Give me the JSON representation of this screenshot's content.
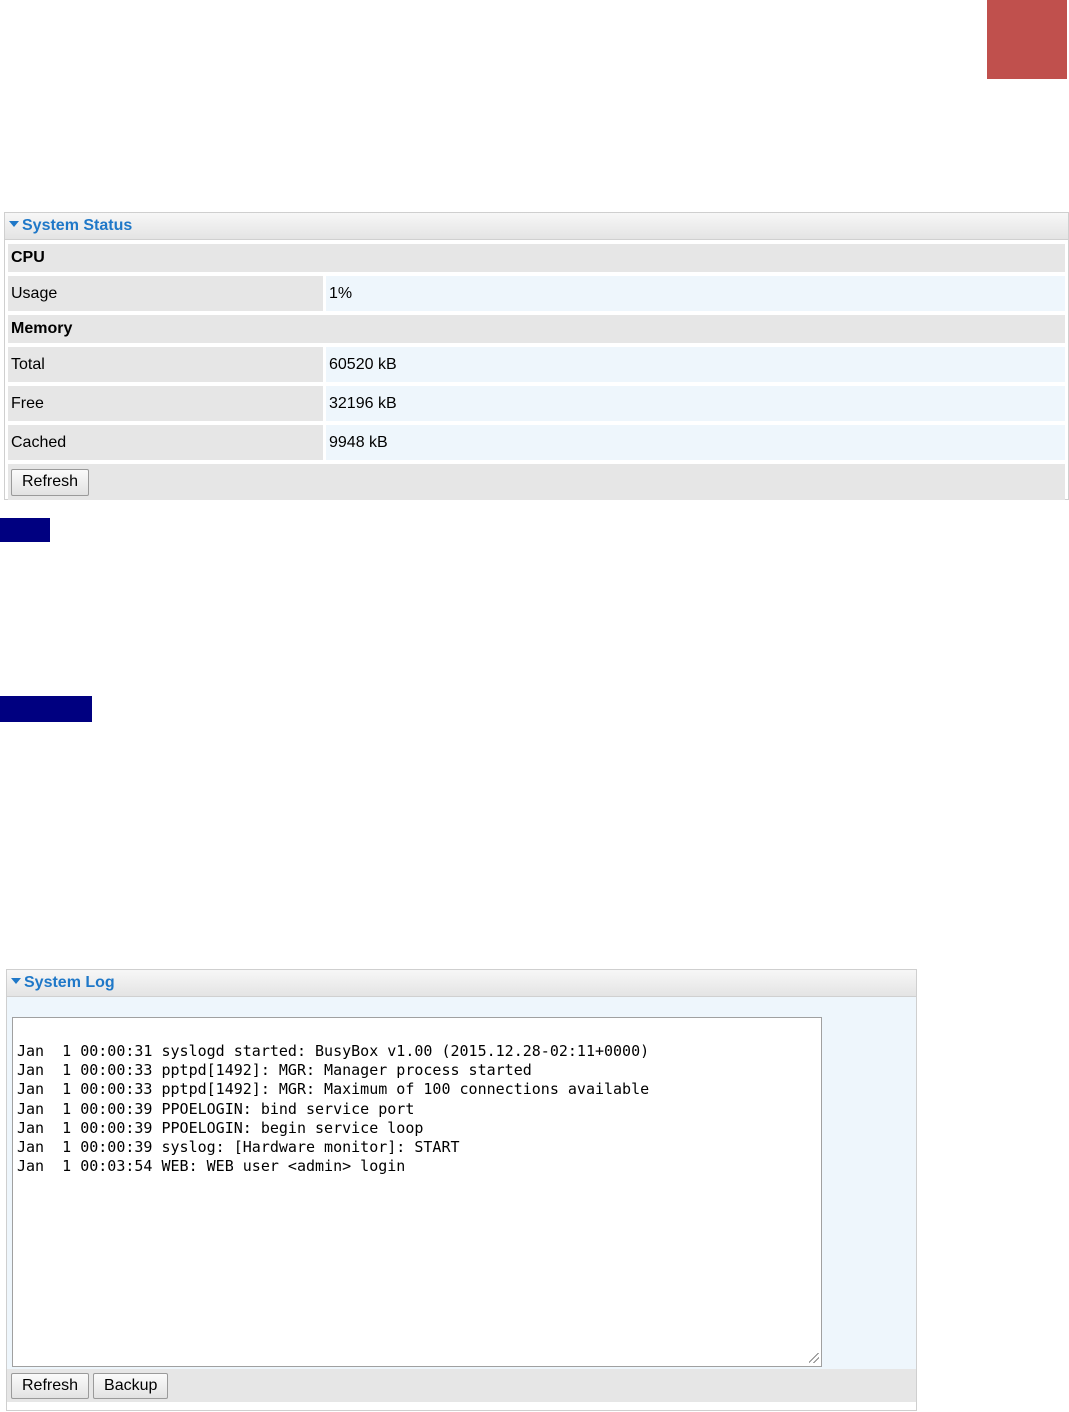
{
  "colors": {
    "corner_block": "#c0504d",
    "nav_block": "#000080",
    "panel_title": "#1f78c8"
  },
  "system_status": {
    "title": "System Status",
    "cpu": {
      "heading": "CPU",
      "usage_label": "Usage",
      "usage_value": "1%"
    },
    "memory": {
      "heading": "Memory",
      "rows": [
        {
          "label": "Total",
          "value": "60520 kB"
        },
        {
          "label": "Free",
          "value": "32196 kB"
        },
        {
          "label": "Cached",
          "value": "9948 kB"
        }
      ]
    },
    "refresh_label": "Refresh"
  },
  "system_log": {
    "title": "System Log",
    "lines": [
      "Jan  1 00:00:31 syslogd started: BusyBox v1.00 (2015.12.28-02:11+0000)",
      "Jan  1 00:00:33 pptpd[1492]: MGR: Manager process started",
      "Jan  1 00:00:33 pptpd[1492]: MGR: Maximum of 100 connections available",
      "Jan  1 00:00:39 PPOELOGIN: bind service port",
      "Jan  1 00:00:39 PPOELOGIN: begin service loop",
      "Jan  1 00:00:39 syslog: [Hardware monitor]: START",
      "Jan  1 00:03:54 WEB: WEB user <admin> login"
    ],
    "refresh_label": "Refresh",
    "backup_label": "Backup"
  }
}
